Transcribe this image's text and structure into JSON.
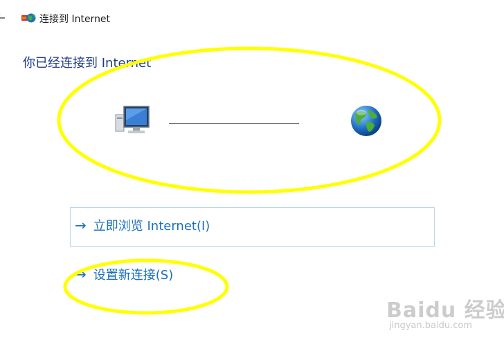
{
  "window": {
    "title": "连接到 Internet",
    "back_icon": "back-arrow-icon",
    "title_icon": "network-globe-icon"
  },
  "main": {
    "heading": "你已经连接到 Internet",
    "diagram": {
      "left_icon": "computer-icon",
      "right_icon": "globe-icon"
    },
    "options": [
      {
        "label": "立即浏览 Internet(I)",
        "icon": "right-arrow-icon"
      },
      {
        "label": "设置新连接(S)",
        "icon": "right-arrow-icon"
      }
    ]
  },
  "annotations": {
    "highlight_color": "#ffff00"
  },
  "watermark": {
    "main": "Baidu 经验",
    "sub": "jingyan.baidu.com"
  },
  "colors": {
    "heading": "#1e3a8c",
    "link": "#1a6fbf",
    "option_border": "#b9d7ea"
  }
}
